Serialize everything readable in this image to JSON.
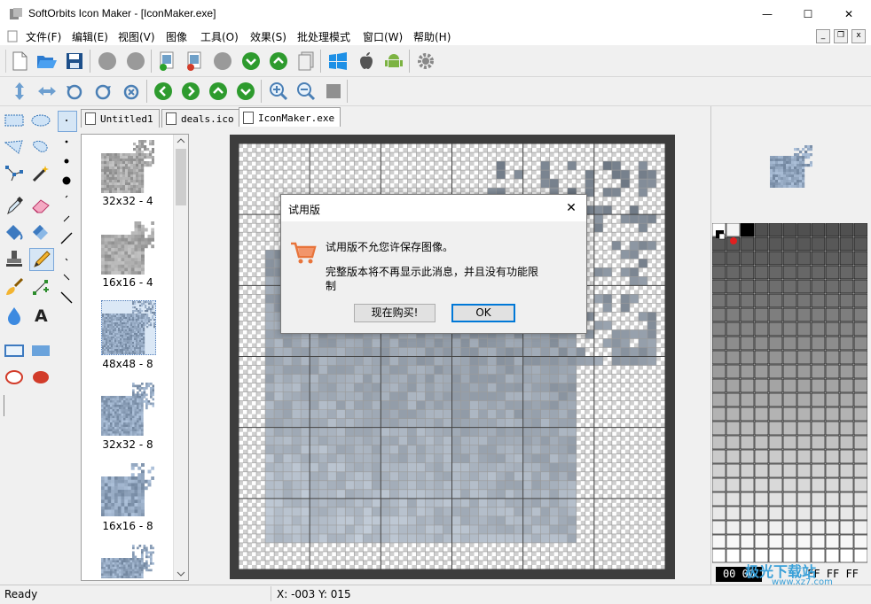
{
  "window": {
    "title": "SoftOrbits Icon Maker - [IconMaker.exe]",
    "controls": {
      "minimize": "—",
      "maximize": "☐",
      "close": "✕"
    }
  },
  "menu": [
    "文件(F)",
    "编辑(E)",
    "视图(V)",
    "图像",
    "工具(O)",
    "效果(S)",
    "批处理模式",
    "窗口(W)",
    "帮助(H)"
  ],
  "mdi": {
    "minimize": "_",
    "restore": "❐",
    "close": "x"
  },
  "tabs": [
    {
      "label": "Untitled1",
      "active": false
    },
    {
      "label": "deals.ico",
      "active": false
    },
    {
      "label": "IconMaker.exe",
      "active": true
    }
  ],
  "images": [
    {
      "label": "32x32 - 4"
    },
    {
      "label": "16x16 - 4"
    },
    {
      "label": "48x48 - 8",
      "selected": true
    },
    {
      "label": "32x32 - 8"
    },
    {
      "label": "16x16 - 8"
    }
  ],
  "colors": {
    "fg_hex": "00 00 00",
    "bg_hex": "FF FF FF"
  },
  "status": {
    "text": "Ready",
    "coords": "X: -003 Y: 015"
  },
  "dialog": {
    "title": "试用版",
    "close": "✕",
    "message1": "试用版不允您许保存图像。",
    "message2": "完整版本将不再显示此消息，并且没有功能限制",
    "buy_button": "现在购买!",
    "ok_button": "OK"
  },
  "watermark": {
    "text": "极光下载站",
    "url": "www.xz7.com"
  }
}
